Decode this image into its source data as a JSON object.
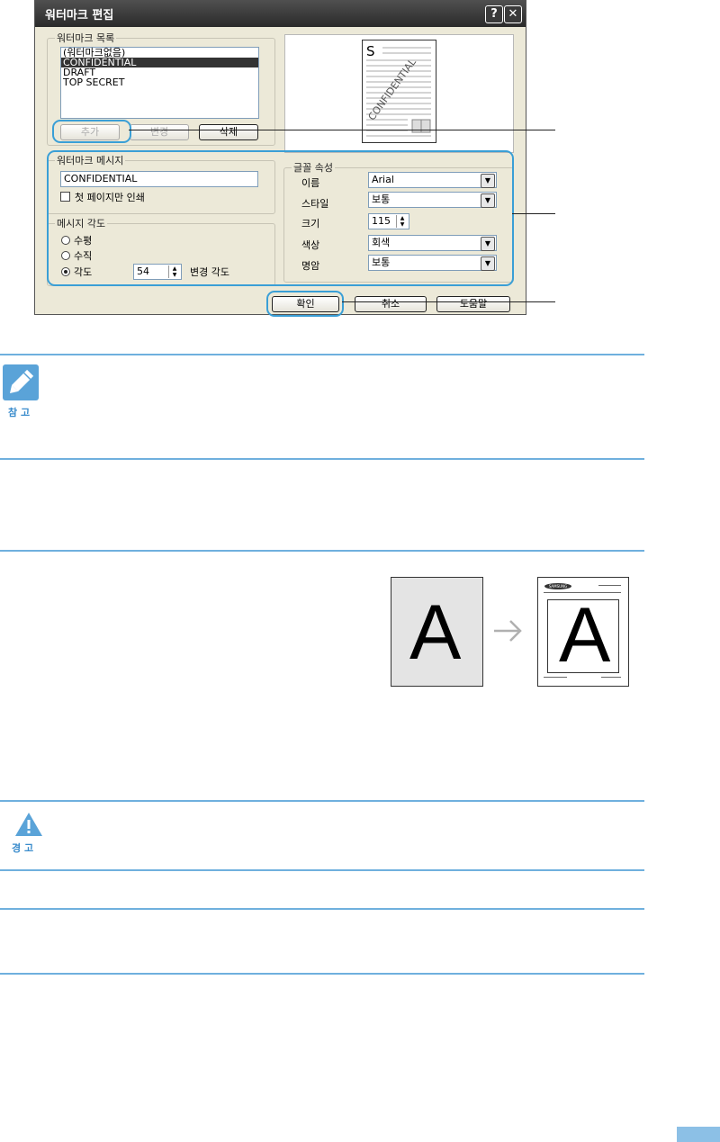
{
  "dialog": {
    "title": "워터마크 편집",
    "help_label": "?",
    "close_label": "✕",
    "list_group": {
      "legend": "워터마크 목록",
      "items": [
        "(워터마크없음)",
        "CONFIDENTIAL",
        "DRAFT",
        "TOP SECRET"
      ],
      "selected_index": 1,
      "add_label": "추가",
      "update_label": "변경",
      "delete_label": "삭제"
    },
    "preview": {
      "logo_letter": "S",
      "watermark_text": "CONFIDENTIAL"
    },
    "message_group": {
      "legend": "워터마크 메시지",
      "message_value": "CONFIDENTIAL",
      "first_page_only_label": "첫 페이지만 인쇄"
    },
    "angle_group": {
      "legend": "메시지 각도",
      "horizontal_label": "수평",
      "vertical_label": "수직",
      "angle_label": "각도",
      "angle_value": "54",
      "angle_suffix": "변경 각도",
      "selected": "angle"
    },
    "font_group": {
      "legend": "글꼴 속성",
      "name_label": "이름",
      "name_value": "Arial",
      "style_label": "스타일",
      "style_value": "보통",
      "size_label": "크기",
      "size_value": "115",
      "color_label": "색상",
      "color_value": "회색",
      "shade_label": "명암",
      "shade_value": "보통"
    },
    "buttons": {
      "ok": "확인",
      "cancel": "취소",
      "help": "도움말"
    }
  },
  "note": {
    "label": "참 고"
  },
  "overlay": {
    "letter": "A",
    "brand": "SAMSUNG"
  },
  "warning": {
    "label": "경 고"
  },
  "colors": {
    "accent": "#3a9fd6",
    "rule": "#6fb0de",
    "dialog_bg": "#ece9d8"
  }
}
